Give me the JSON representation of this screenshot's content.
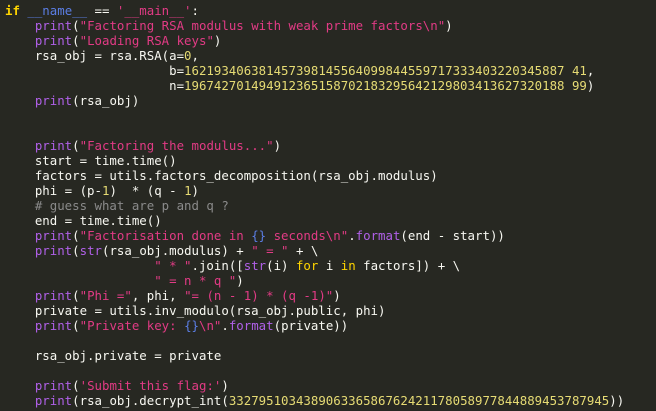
{
  "editor": {
    "language": "python",
    "theme": {
      "background": "#272822",
      "text": "#f8f8f2",
      "keyword": "#ffd500",
      "builtin": "#b060e8",
      "string": "#e23b85",
      "number": "#e6db74",
      "dunder": "#5b7ee5",
      "comment": "#8a8a8a"
    },
    "lines": [
      [
        [
          "kwb",
          "if"
        ],
        [
          "op",
          " "
        ],
        [
          "dn",
          "__name__"
        ],
        [
          "op",
          " == "
        ],
        [
          "str",
          "'__main__'"
        ],
        [
          "op",
          ":"
        ]
      ],
      [
        [
          "op",
          "    "
        ],
        [
          "fn",
          "print"
        ],
        [
          "op",
          "("
        ],
        [
          "str",
          "\"Factoring RSA modulus with weak prime factors\\n\""
        ],
        [
          "op",
          ")"
        ]
      ],
      [
        [
          "op",
          "    "
        ],
        [
          "fn",
          "print"
        ],
        [
          "op",
          "("
        ],
        [
          "str",
          "\"Loading RSA keys\""
        ],
        [
          "op",
          ")"
        ]
      ],
      [
        [
          "op",
          "    rsa_obj = rsa.RSA(a="
        ],
        [
          "num",
          "0"
        ],
        [
          "op",
          ","
        ]
      ],
      [
        [
          "op",
          "                      b="
        ],
        [
          "num",
          "162193406381457398145564099844559717333403220345887 41"
        ],
        [
          "op",
          ","
        ]
      ],
      [
        [
          "op",
          "                      n="
        ],
        [
          "num",
          "196742701494912365158702183295642129803413627320188 99"
        ],
        [
          "op",
          ")"
        ]
      ],
      [
        [
          "op",
          "    "
        ],
        [
          "fn",
          "print"
        ],
        [
          "op",
          "(rsa_obj)"
        ]
      ],
      [],
      [],
      [
        [
          "op",
          "    "
        ],
        [
          "fn",
          "print"
        ],
        [
          "op",
          "("
        ],
        [
          "str",
          "\"Factoring the modulus...\""
        ],
        [
          "op",
          ")"
        ]
      ],
      [
        [
          "op",
          "    start = time.time()"
        ]
      ],
      [
        [
          "op",
          "    factors = utils.factors_decomposition(rsa_obj.modulus)"
        ]
      ],
      [
        [
          "op",
          "    phi = (p-"
        ],
        [
          "num",
          "1"
        ],
        [
          "op",
          ")  * (q - "
        ],
        [
          "num",
          "1"
        ],
        [
          "op",
          ")"
        ]
      ],
      [
        [
          "cmt",
          "    # guess what are p and q ?"
        ]
      ],
      [
        [
          "op",
          "    end = time.time()"
        ]
      ],
      [
        [
          "op",
          "    "
        ],
        [
          "fn",
          "print"
        ],
        [
          "op",
          "("
        ],
        [
          "str",
          "\"Factorisation done in "
        ],
        [
          "dn",
          "{}"
        ],
        [
          "str",
          " seconds\\n\""
        ],
        [
          "op",
          "."
        ],
        [
          "fn",
          "format"
        ],
        [
          "op",
          "(end - start))"
        ]
      ],
      [
        [
          "op",
          "    "
        ],
        [
          "fn",
          "print"
        ],
        [
          "op",
          "("
        ],
        [
          "fn",
          "str"
        ],
        [
          "op",
          "(rsa_obj.modulus) + "
        ],
        [
          "str",
          "\" = \""
        ],
        [
          "op",
          " + \\"
        ]
      ],
      [
        [
          "op",
          "                    "
        ],
        [
          "str",
          "\" * \""
        ],
        [
          "op",
          ".join(["
        ],
        [
          "fn",
          "str"
        ],
        [
          "op",
          "(i) "
        ],
        [
          "kw",
          "for"
        ],
        [
          "op",
          " i "
        ],
        [
          "kw",
          "in"
        ],
        [
          "op",
          " factors]) + \\"
        ]
      ],
      [
        [
          "op",
          "                    "
        ],
        [
          "str",
          "\" = n * q \""
        ],
        [
          "op",
          ")"
        ]
      ],
      [
        [
          "op",
          "    "
        ],
        [
          "fn",
          "print"
        ],
        [
          "op",
          "("
        ],
        [
          "str",
          "\"Phi =\""
        ],
        [
          "op",
          ", phi, "
        ],
        [
          "str",
          "\"= (n - 1) * (q -1)\""
        ],
        [
          "op",
          ")"
        ]
      ],
      [
        [
          "op",
          "    private = utils.inv_modulo(rsa_obj.public, phi)"
        ]
      ],
      [
        [
          "op",
          "    "
        ],
        [
          "fn",
          "print"
        ],
        [
          "op",
          "("
        ],
        [
          "str",
          "\"Private key: "
        ],
        [
          "dn",
          "{}"
        ],
        [
          "str",
          "\\n\""
        ],
        [
          "op",
          "."
        ],
        [
          "fn",
          "format"
        ],
        [
          "op",
          "(private))"
        ]
      ],
      [],
      [
        [
          "op",
          "    rsa_obj.private = private"
        ]
      ],
      [],
      [
        [
          "op",
          "    "
        ],
        [
          "fn",
          "print"
        ],
        [
          "op",
          "("
        ],
        [
          "str",
          "'Submit this flag:'"
        ],
        [
          "op",
          ")"
        ]
      ],
      [
        [
          "op",
          "    "
        ],
        [
          "fn",
          "print"
        ],
        [
          "op",
          "(rsa_obj.decrypt_int("
        ],
        [
          "num",
          "332795103438906336586762421178058977844889453787945"
        ],
        [
          "op",
          "))"
        ]
      ]
    ]
  }
}
